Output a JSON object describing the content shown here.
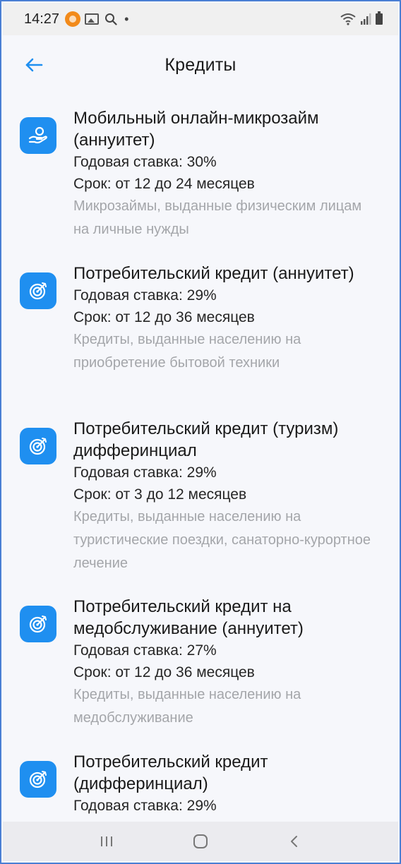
{
  "status_bar": {
    "time": "14:27",
    "dot": "•",
    "icons": [
      "notification-dot-icon",
      "gallery-icon",
      "search-icon",
      "wifi-icon",
      "signal-icon",
      "battery-icon"
    ]
  },
  "header": {
    "title": "Кредиты",
    "back_icon": "arrow-left-icon"
  },
  "colors": {
    "accent": "#1f8ff0",
    "desc_text": "#a4a6aa",
    "background": "#f6f7fb"
  },
  "loans": [
    {
      "icon": "hand-money-icon",
      "title": "Мобильный онлайн-микрозайм (аннуитет)",
      "rate": "Годовая ставка: 30%",
      "term": "Срок: от 12 до 24 месяцев",
      "description": "Микрозаймы, выданные физическим лицам на личные нужды"
    },
    {
      "icon": "target-icon",
      "title": "Потребительский кредит (аннуитет)",
      "rate": "Годовая ставка: 29%",
      "term": "Срок: от 12 до 36 месяцев",
      "description": "Кредиты, выданные населению на приобретение бытовой техники"
    },
    {
      "icon": "target-icon",
      "title": "Потребительский кредит (туризм) дифферинциал",
      "rate": "Годовая ставка: 29%",
      "term": "Срок: от 3 до 12 месяцев",
      "description": "Кредиты, выданные населению на туристические поездки, санаторно-курортное лечение"
    },
    {
      "icon": "target-icon",
      "title": "Потребительский кредит на медобслуживание (аннуитет)",
      "rate": "Годовая ставка: 27%",
      "term": "Срок: от 12 до 36 месяцев",
      "description": "Кредиты, выданные населению на медобслуживание"
    },
    {
      "icon": "target-icon",
      "title": "Потребительский кредит (дифферинциал)",
      "rate": "Годовая ставка: 29%",
      "term": "",
      "description": ""
    }
  ],
  "nav_bar": {
    "icons": [
      "recent-apps-icon",
      "home-icon",
      "back-chevron-icon"
    ]
  }
}
